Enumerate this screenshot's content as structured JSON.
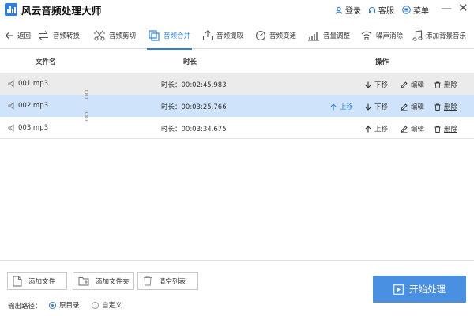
{
  "app": {
    "title": "风云音频处理大师"
  },
  "titlebar": {
    "login": "登录",
    "service": "客服",
    "menu": "菜单",
    "minimize": "—",
    "close": "✕"
  },
  "toolbar": {
    "back": "返回",
    "convert": "音频转换",
    "cut": "音频剪切",
    "merge": "音频合并",
    "extract": "音频提取",
    "speed": "音频变速",
    "volume": "音量调整",
    "denoise": "噪声消除",
    "bgmusic": "添加背景音乐",
    "active": "音频合并"
  },
  "table": {
    "headers": {
      "file": "文件名",
      "duration": "时长",
      "ops": "操作"
    },
    "rows": [
      {
        "file": "001.mp3",
        "duration": "时长：00:02:45.983",
        "selected": false
      },
      {
        "file": "002.mp3",
        "duration": "时长：00:03:25.766",
        "selected": true
      },
      {
        "file": "003.mp3",
        "duration": "时长：00:03:34.675",
        "selected": false
      }
    ],
    "actions": {
      "up": "上移",
      "down": "下移",
      "edit": "编辑",
      "delete": "删除"
    }
  },
  "bottom": {
    "add_file": "添加文件",
    "add_folder": "添加文件夹",
    "clear": "清空列表",
    "output_label": "输出路径：",
    "opt_original": "原目录",
    "opt_custom": "自定义",
    "output_selected": "原目录",
    "start": "开始处理"
  },
  "colors": {
    "accent": "#2f7fe0",
    "selected_row": "#cfe4fa",
    "hover_row": "#ebebeb",
    "start_button": "#4a90e2"
  }
}
